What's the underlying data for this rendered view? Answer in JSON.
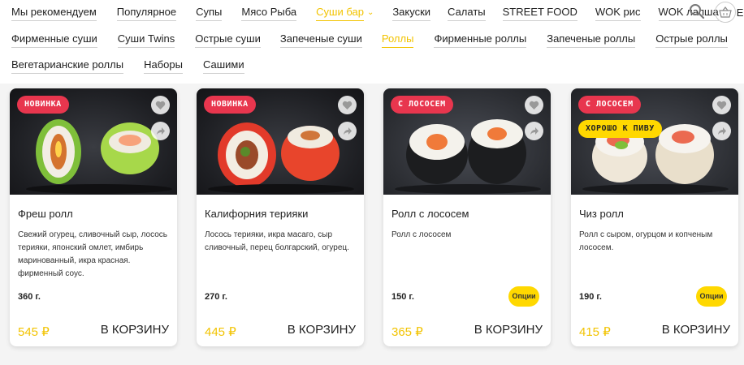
{
  "nav": {
    "row1": [
      "Мы рекомендуем",
      "Популярное",
      "Супы",
      "Мясо Рыба",
      "Суши бар",
      "Закуски",
      "Салаты",
      "STREET FOOD",
      "WOK рис",
      "WOK лапша",
      "Ещё"
    ],
    "row2": [
      "Фирменные суши",
      "Суши Twins",
      "Острые суши",
      "Запеченые суши",
      "Роллы",
      "Фирменные роллы",
      "Запеченые роллы",
      "Острые роллы"
    ],
    "row3": [
      "Вегетарианские роллы",
      "Наборы",
      "Сашими"
    ],
    "active_row1": "Суши бар",
    "active_row2": "Роллы"
  },
  "icons": {
    "search": "search-icon",
    "basket": "basket-icon",
    "heart": "heart-icon",
    "share": "share-icon"
  },
  "colors": {
    "accent": "#ffd800",
    "accent_text": "#f2c300",
    "badge_red": "#e8364e"
  },
  "products": [
    {
      "badges": [
        {
          "text": "НОВИНКА",
          "color": "red"
        }
      ],
      "name": "Фреш ролл",
      "description": "Свежий огурец, сливочный сыр, лосось терияки, японский омлет, имбирь маринованный, икра красная. фирменный соус.",
      "weight": "360 г.",
      "options": "",
      "price": "545 ₽",
      "cart": "В КОРЗИНУ"
    },
    {
      "badges": [
        {
          "text": "НОВИНКА",
          "color": "red"
        }
      ],
      "name": "Калифорния терияки",
      "description": "Лосось терияки, икра масаго, сыр сливочный, перец болгарский, огурец.",
      "weight": "270 г.",
      "options": "",
      "price": "445 ₽",
      "cart": "В КОРЗИНУ"
    },
    {
      "badges": [
        {
          "text": "С ЛОСОСЕМ",
          "color": "red"
        }
      ],
      "name": "Ролл с лососем",
      "description": "Ролл с лососем",
      "weight": "150 г.",
      "options": "Опции",
      "price": "365 ₽",
      "cart": "В КОРЗИНУ"
    },
    {
      "badges": [
        {
          "text": "С ЛОСОСЕМ",
          "color": "red"
        },
        {
          "text": "ХОРОШО К ПИВУ",
          "color": "yellow"
        }
      ],
      "name": "Чиз ролл",
      "description": "Ролл с сыром, огурцом и копченым лососем.",
      "weight": "190 г.",
      "options": "Опции",
      "price": "415 ₽",
      "cart": "В КОРЗИНУ"
    }
  ]
}
